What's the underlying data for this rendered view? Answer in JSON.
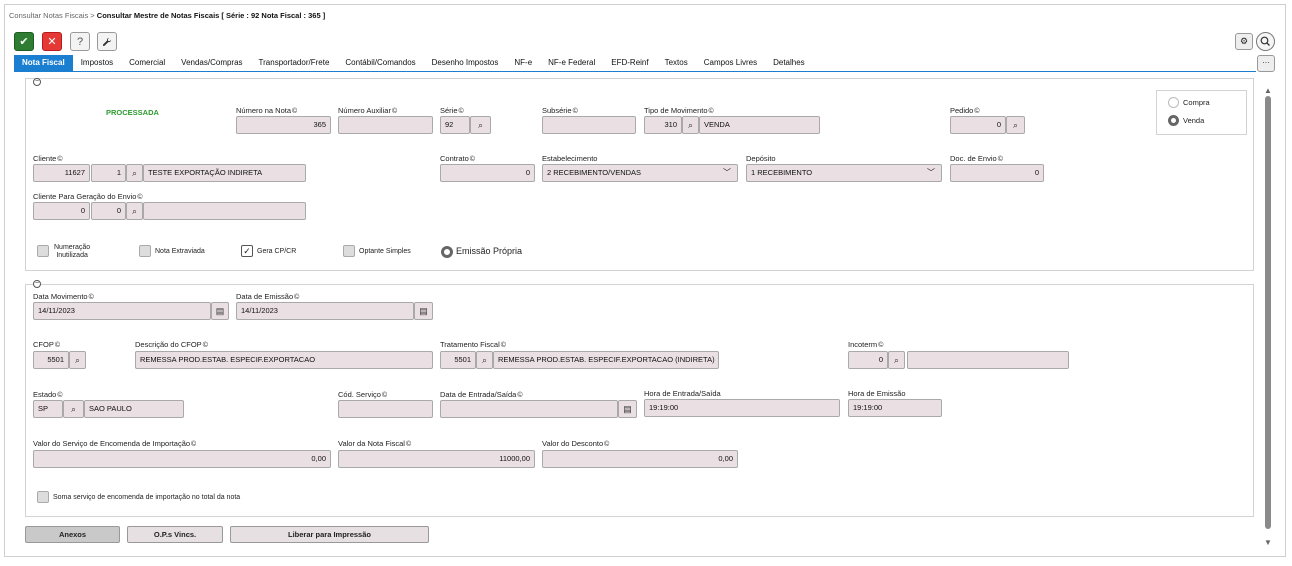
{
  "breadcrumb": {
    "parent": "Consultar Notas Fiscais",
    "sep": ">",
    "current": "Consultar Mestre de Notas Fiscais [ Série : 92 Nota Fiscal : 365 ]"
  },
  "toolbar": {
    "ok_icon": "✔",
    "cancel_icon": "✕",
    "help_icon": "?",
    "tool_icon": "🔧",
    "settings_icon": "⚙",
    "search_icon": "🔍",
    "more_icon": "···"
  },
  "tabs": [
    "Nota Fiscal",
    "Impostos",
    "Comercial",
    "Vendas/Compras",
    "Transportador/Frete",
    "Contábil/Comandos",
    "Desenho Impostos",
    "NF-e",
    "NF-e Federal",
    "EFD-Reinf",
    "Textos",
    "Campos Livres",
    "Detalhes"
  ],
  "status": {
    "text": "PROCESSADA",
    "color": "#2e9b2e"
  },
  "labels": {
    "numero_nota": "Número na Nota",
    "numero_aux": "Número Auxiliar",
    "serie": "Série",
    "subserie": "Subsérie",
    "tipo_mov": "Tipo de Movimento",
    "pedido": "Pedido",
    "cliente": "Cliente",
    "contrato": "Contrato",
    "estabelecimento": "Estabelecimento",
    "deposito": "Depósito",
    "doc_envio": "Doc. de Envio",
    "cliente_envio": "Cliente Para Geração do Envio",
    "data_mov": "Data Movimento",
    "data_emissao": "Data de Emissão",
    "cfop": "CFOP",
    "desc_cfop": "Descrição do CFOP",
    "trat_fiscal": "Tratamento Fiscal",
    "incoterm": "Incoterm",
    "estado": "Estado",
    "cod_servico": "Cód. Serviço",
    "data_entrada": "Data de Entrada/Saída",
    "hora_entrada": "Hora de Entrada/Saída",
    "hora_emissao": "Hora de Emissão",
    "valor_servico": "Valor do Serviço de Encomenda de Importação",
    "valor_nota": "Valor da Nota Fiscal",
    "valor_desconto": "Valor do Desconto",
    "info_icon": "©"
  },
  "values": {
    "numero_nota": "365",
    "numero_aux": "",
    "serie": "92",
    "subserie": "",
    "tipo_mov_code": "310",
    "tipo_mov_desc": "VENDA",
    "pedido": "0",
    "cliente_code": "11627",
    "cliente_seq": "1",
    "cliente_name": "TESTE EXPORTAÇÃO INDIRETA",
    "contrato": "0",
    "estabelecimento": "2 RECEBIMENTO/VENDAS",
    "deposito": "1 RECEBIMENTO",
    "doc_envio": "0",
    "cliente_envio_code": "0",
    "cliente_envio_seq": "0",
    "cliente_envio_name": "",
    "data_mov": "14/11/2023",
    "data_emissao": "14/11/2023",
    "cfop": "5501",
    "desc_cfop": "REMESSA PROD.ESTAB. ESPECIF.EXPORTACAO",
    "trat_code": "5501",
    "trat_desc": "REMESSA PROD.ESTAB. ESPECIF.EXPORTACAO (INDIRETA)",
    "incoterm_code": "0",
    "incoterm_desc": "",
    "estado_uf": "SP",
    "estado_nome": "SAO PAULO",
    "cod_servico": "",
    "data_entrada": "",
    "hora_entrada": "19:19:00",
    "hora_emissao": "19:19:00",
    "valor_servico": "0,00",
    "valor_nota": "11000,00",
    "valor_desconto": "0,00"
  },
  "radio_tipo": {
    "compra": "Compra",
    "venda": "Venda",
    "selected": "venda"
  },
  "checkboxes": {
    "numeracao": "Numeração\nInutilizada",
    "nota_extraviada": "Nota Extraviada",
    "gera_cp": "Gera CP/CR",
    "optante": "Optante Simples",
    "emissao_propria": "Emissão Própria",
    "soma_servico": "Soma serviço de encomenda de importação no total da nota"
  },
  "buttons": {
    "anexos": "Anexos",
    "ops": "O.P.s Vincs.",
    "liberar": "Liberar para Impressão"
  }
}
